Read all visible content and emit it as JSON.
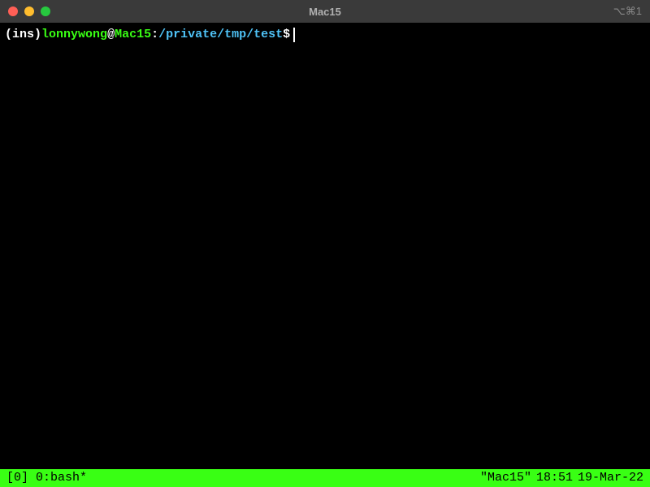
{
  "window": {
    "title": "Mac15",
    "shortcut_hint": "⌥⌘1"
  },
  "prompt": {
    "mode_open": "(",
    "mode": "ins",
    "mode_close": ")",
    "user": "lonnywong",
    "at": "@",
    "host": "Mac15",
    "colon": ":",
    "path": "/private/tmp/test",
    "dollar": "$"
  },
  "tmux": {
    "session_window": "[0] 0:bash*",
    "hostname": "\"Mac15\"",
    "time": "18:51",
    "date": "19-Mar-22"
  }
}
